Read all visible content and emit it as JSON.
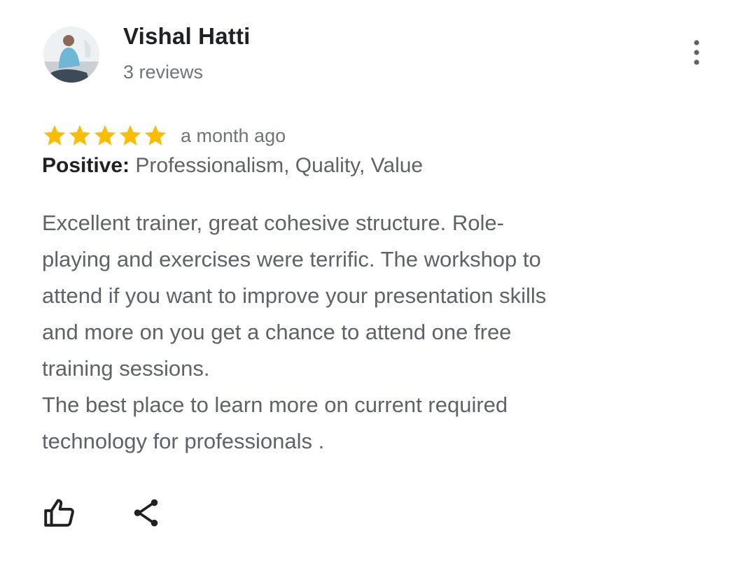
{
  "reviewer": {
    "name": "Vishal Hatti",
    "review_count": "3 reviews",
    "avatar_icon": "profile-photo"
  },
  "menu": {
    "icon": "more-vert-icon"
  },
  "rating": {
    "stars": 5,
    "max_stars": 5,
    "date": "a month ago",
    "star_color": "#fbbc04"
  },
  "highlights": {
    "label": "Positive:",
    "values": "Professionalism, Quality, Value"
  },
  "review": {
    "lines": [
      "Excellent trainer, great cohesive structure. Role-",
      "playing and exercises were terrific. The workshop to",
      "attend if you want to improve your presentation skills",
      "and more on you get a chance to attend one free",
      "training sessions.",
      "The best place to learn more on current required",
      "technology for professionals ."
    ]
  },
  "actions": {
    "like_icon": "thumb-up-icon",
    "share_icon": "share-icon"
  }
}
